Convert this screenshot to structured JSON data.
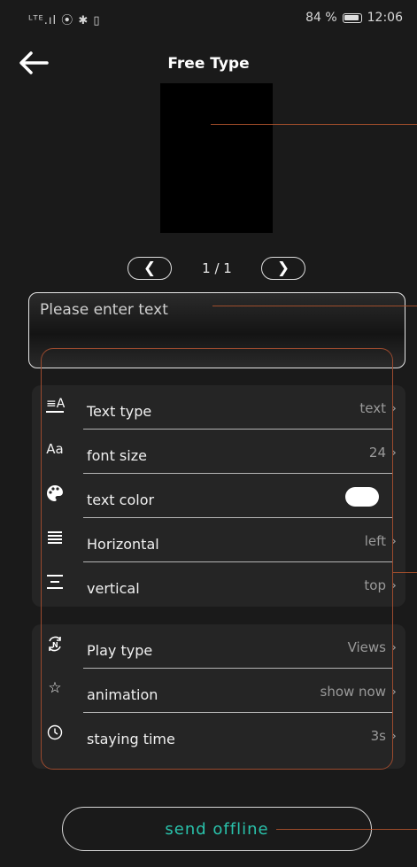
{
  "status": {
    "left": "ᴸᵀᴱ.ıl ⦿ ✱ ▯",
    "battery": "84 %",
    "time": "12:06"
  },
  "header": {
    "title": "Free Type"
  },
  "pager": {
    "prev": "❮",
    "count": "1 / 1",
    "next": "❯"
  },
  "input": {
    "placeholder": "Please enter text",
    "value": ""
  },
  "settings": {
    "text_type": {
      "label": "Text type",
      "value": "text",
      "icon": "text-type-icon"
    },
    "font_size": {
      "label": "font size",
      "value": "24",
      "icon": "font-size-icon"
    },
    "text_color": {
      "label": "text color",
      "value": "#ffffff",
      "icon": "palette-icon"
    },
    "horizontal": {
      "label": "Horizontal",
      "value": "left",
      "icon": "align-horizontal-icon"
    },
    "vertical": {
      "label": "vertical",
      "value": "top",
      "icon": "align-vertical-icon"
    },
    "play_type": {
      "label": "Play type",
      "value": "Views",
      "icon": "play-type-icon"
    },
    "animation": {
      "label": "animation",
      "value": "show now",
      "icon": "star-icon"
    },
    "staying_time": {
      "label": "staying time",
      "value": "3s",
      "icon": "clock-icon"
    }
  },
  "send": {
    "label": "send offline"
  },
  "colors": {
    "accent": "#29c2ab",
    "background": "#1a1a1a",
    "card": "#252525",
    "annotation": "#b5562e"
  }
}
